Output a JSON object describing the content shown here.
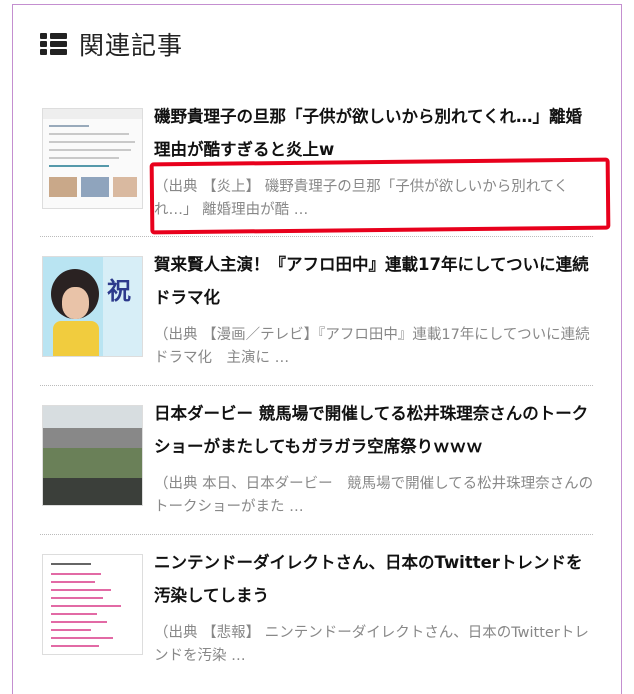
{
  "section": {
    "title": "関連記事",
    "icon": "list-icon"
  },
  "articles": [
    {
      "title": "磯野貴理子の旦那「子供が欲しいから別れてくれ…」離婚理由が酷すぎると炎上w",
      "excerpt": "（出典 【炎上】 磯野貴理子の旦那「子供が欲しいから別れてくれ…」 離婚理由が酷 …"
    },
    {
      "title": "賀来賢人主演！『アフロ田中』連載17年にしてついに連続ドラマ化",
      "excerpt": "（出典 【漫画／テレビ】『アフロ田中』連載17年にしてついに連続ドラマ化　主演に …",
      "thumb_text": "祝"
    },
    {
      "title": "日本ダービー 競馬場で開催してる松井珠理奈さんのトークショーがまたしてもガラガラ空席祭りｗｗｗ",
      "excerpt": "（出典 本日、日本ダービー　競馬場で開催してる松井珠理奈さんのトークショーがまた …"
    },
    {
      "title": "ニンテンドーダイレクトさん、日本のTwitterトレンドを汚染してしまう",
      "excerpt": "（出典 【悲報】 ニンテンドーダイレクトさん、日本のTwitterトレンドを汚染 …"
    }
  ],
  "colors": {
    "frame_border": "#c48fd0",
    "highlight_box": "#e8001c",
    "title_text": "#111111",
    "excerpt_text": "#888888"
  }
}
